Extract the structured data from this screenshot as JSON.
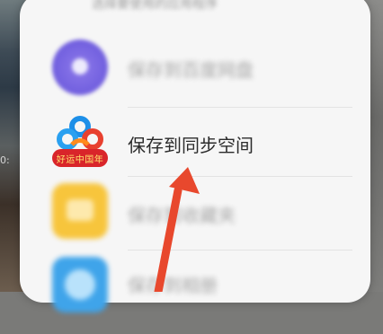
{
  "background": {
    "time_fragment": "0:"
  },
  "sheet": {
    "header_text": "选择要使用的应用程序",
    "items": [
      {
        "label": "保存到百度网盘",
        "icon": "purple-circle-icon"
      },
      {
        "label": "保存到同步空间",
        "icon": "baidu-cloud-icon",
        "badge": "好运中国年"
      },
      {
        "label": "保存到收藏夹",
        "icon": "yellow-folder-icon"
      },
      {
        "label": "保存到相册",
        "icon": "blue-gallery-icon"
      }
    ]
  },
  "colors": {
    "sheet_bg": "#f6f6f6",
    "arrow": "#e8482d",
    "badge_red": "#d9252a",
    "badge_text": "#ffe36d"
  }
}
